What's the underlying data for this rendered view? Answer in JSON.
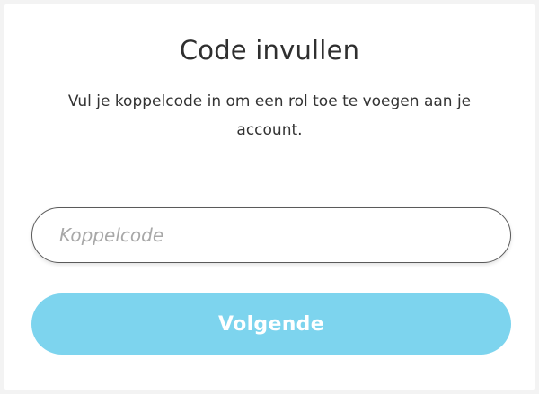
{
  "dialog": {
    "title": "Code invullen",
    "subtitle": "Vul je koppelcode in om een rol toe te voegen aan je account."
  },
  "code_field": {
    "placeholder": "Koppelcode",
    "value": ""
  },
  "next_button": {
    "label": "Volgende"
  },
  "colors": {
    "button": "#7dd4ee",
    "button_text": "#ffffff",
    "input_border": "#5a5a5a",
    "placeholder": "#a8a8a8"
  }
}
